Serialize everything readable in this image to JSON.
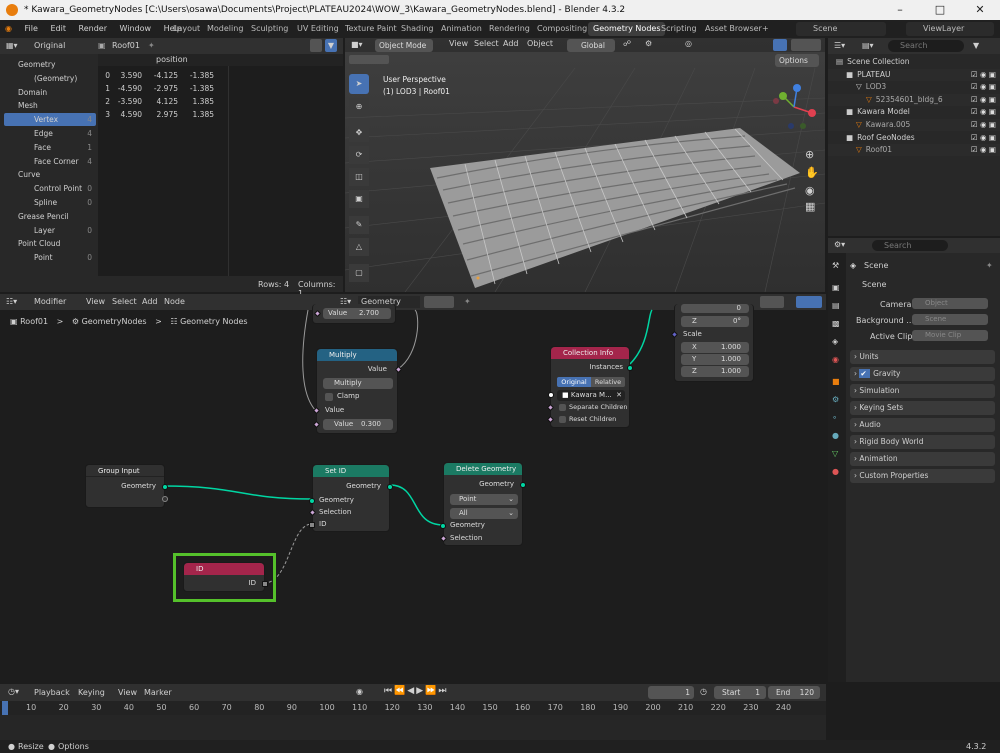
{
  "window": {
    "title": "* Kawara_GeometryNodes [C:\\Users\\osawa\\Documents\\Project\\PLATEAU2024\\WOW_3\\Kawara_GeometryNodes.blend] - Blender 4.3.2"
  },
  "menu": [
    "File",
    "Edit",
    "Render",
    "Window",
    "Help"
  ],
  "workspaces": [
    "Layout",
    "Modeling",
    "Sculpting",
    "UV Editing",
    "Texture Paint",
    "Shading",
    "Animation",
    "Rendering",
    "Compositing",
    "Geometry Nodes",
    "Scripting",
    "Asset Browser"
  ],
  "active_workspace": "Geometry Nodes",
  "scene": {
    "name": "Scene",
    "view_layer": "ViewLayer"
  },
  "spreadsheet": {
    "display_mode": "Original",
    "object": "Roof01",
    "tree": [
      {
        "label": "Geometry",
        "indent": 0
      },
      {
        "label": "(Geometry)",
        "indent": 1
      },
      {
        "label": "Domain",
        "indent": 0
      },
      {
        "label": "Mesh",
        "indent": 0
      },
      {
        "label": "Vertex",
        "count": "4",
        "indent": 1,
        "selected": true
      },
      {
        "label": "Edge",
        "count": "4",
        "indent": 1
      },
      {
        "label": "Face",
        "count": "1",
        "indent": 1
      },
      {
        "label": "Face Corner",
        "count": "4",
        "indent": 1
      },
      {
        "label": "Curve",
        "indent": 0
      },
      {
        "label": "Control Point",
        "count": "0",
        "indent": 1
      },
      {
        "label": "Spline",
        "count": "0",
        "indent": 1
      },
      {
        "label": "Grease Pencil",
        "indent": 0
      },
      {
        "label": "Layer",
        "count": "0",
        "indent": 1
      },
      {
        "label": "Point Cloud",
        "indent": 0
      },
      {
        "label": "Point",
        "count": "0",
        "indent": 1
      }
    ],
    "column": "position",
    "rows": [
      {
        "i": "0",
        "x": "3.590",
        "y": "-4.125",
        "z": "-1.385"
      },
      {
        "i": "1",
        "x": "-4.590",
        "y": "-2.975",
        "z": "-1.385"
      },
      {
        "i": "2",
        "x": "-3.590",
        "y": "4.125",
        "z": "1.385"
      },
      {
        "i": "3",
        "x": "4.590",
        "y": "2.975",
        "z": "1.385"
      }
    ],
    "footer_rows": "Rows: 4",
    "footer_cols": "Columns: 1"
  },
  "viewport": {
    "mode": "Object Mode",
    "menus": [
      "View",
      "Select",
      "Add",
      "Object"
    ],
    "orientation": "Global",
    "options": "Options",
    "perspective": "User Perspective",
    "collection_info": "(1) LOD3 | Roof01"
  },
  "outliner": {
    "search_placeholder": "Search",
    "items": [
      {
        "label": "Scene Collection",
        "indent": 0
      },
      {
        "label": "PLATEAU",
        "indent": 1
      },
      {
        "label": "LOD3",
        "indent": 2
      },
      {
        "label": "52354601_bldg_6",
        "indent": 3
      },
      {
        "label": "Kawara Model",
        "indent": 1
      },
      {
        "label": "Kawara.005",
        "indent": 2
      },
      {
        "label": "Roof GeoNodes",
        "indent": 1
      },
      {
        "label": "Roof01",
        "indent": 2
      }
    ]
  },
  "properties": {
    "search_placeholder": "Search",
    "scene_label": "Scene",
    "scene_section": "Scene",
    "camera_label": "Camera",
    "camera_placeholder": "Object",
    "background_label": "Background ...",
    "background_placeholder": "Scene",
    "active_clip_label": "Active Clip",
    "active_clip_placeholder": "Movie Clip",
    "sections": [
      "Units",
      "Gravity",
      "Simulation",
      "Keying Sets",
      "Audio",
      "Rigid Body World",
      "Animation",
      "Custom Properties"
    ]
  },
  "node_editor": {
    "editor_type": "Modifier",
    "menus": [
      "View",
      "Select",
      "Add",
      "Node"
    ],
    "tree_name": "Geometry Nodes",
    "breadcrumb": [
      "Roof01",
      "GeometryNodes",
      "Geometry Nodes"
    ],
    "nodes": {
      "value_top": {
        "label": "Value",
        "value": "2.700"
      },
      "multiply": {
        "title": "Multiply",
        "output": "Value",
        "op": "Multiply",
        "clamp": "Clamp",
        "input": "Value",
        "value_label": "Value",
        "value": "0.300"
      },
      "collection_info": {
        "title": "Collection Info",
        "output": "Instances",
        "tab_original": "Original",
        "tab_relative": "Relative",
        "collection": "Kawara M...",
        "separate": "Separate Children",
        "reset": "Reset Children"
      },
      "transform_frag": {
        "y": "0",
        "z_label": "Z",
        "z": "0°",
        "scale": "Scale",
        "x_label": "X",
        "sx": "1.000",
        "y_label": "Y",
        "sy": "1.000",
        "z2_label": "Z",
        "sz": "1.000"
      },
      "group_input": {
        "title": "Group Input",
        "output": "Geometry"
      },
      "set_id": {
        "title": "Set ID",
        "output": "Geometry",
        "in_geo": "Geometry",
        "in_sel": "Selection",
        "in_id": "ID"
      },
      "delete_geo": {
        "title": "Delete Geometry",
        "output": "Geometry",
        "domain": "Point",
        "mode": "All",
        "in_geo": "Geometry",
        "in_sel": "Selection"
      },
      "id": {
        "title": "ID",
        "output": "ID"
      }
    }
  },
  "timeline": {
    "menus": [
      "Playback",
      "Keying",
      "View",
      "Marker"
    ],
    "current_frame": "1",
    "start_label": "Start",
    "start": "1",
    "end_label": "End",
    "end": "120",
    "ticks": [
      "10",
      "20",
      "30",
      "40",
      "50",
      "60",
      "70",
      "80",
      "90",
      "100",
      "110",
      "120",
      "130",
      "140",
      "150",
      "160",
      "170",
      "180",
      "190",
      "200",
      "210",
      "220",
      "230",
      "240"
    ]
  },
  "status": {
    "resize": "Resize",
    "options": "Options",
    "version": "4.3.2"
  },
  "colors": {
    "accent": "#4772b3",
    "geometry_socket": "#00d6a3",
    "highlight": "#55c12b"
  }
}
